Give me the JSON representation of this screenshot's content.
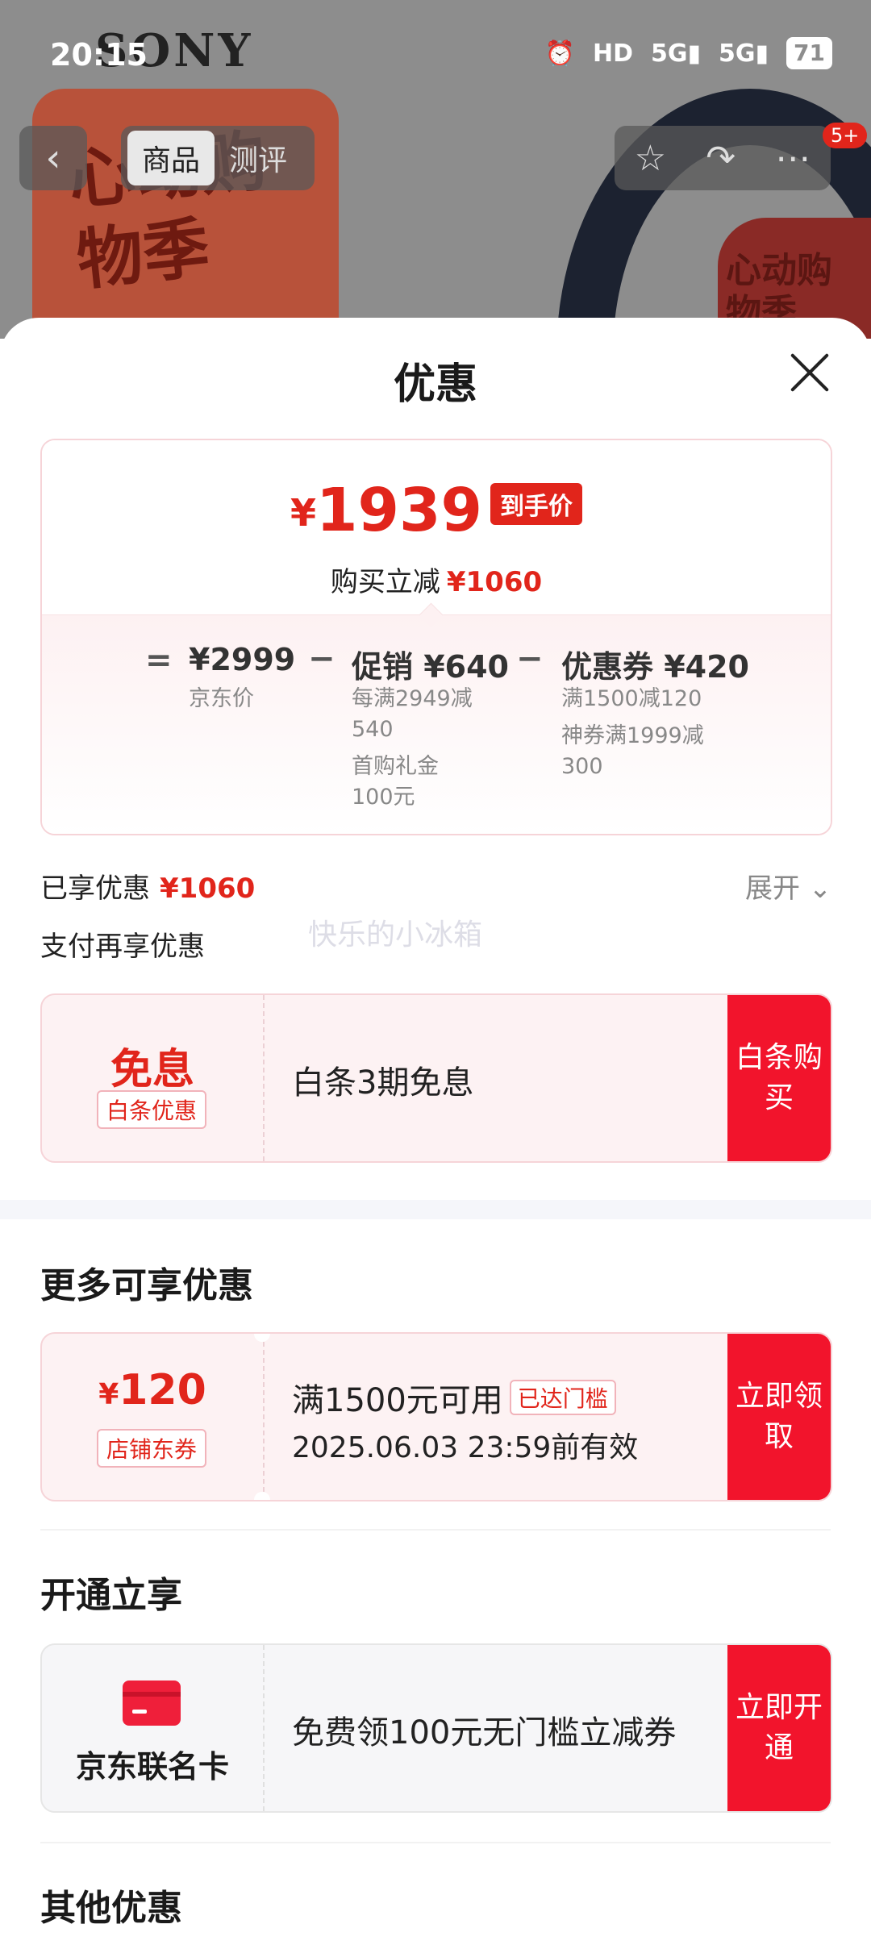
{
  "status_bar": {
    "time": "20:15",
    "hd": "HD",
    "signal1": "5G",
    "signal2": "5G",
    "battery": "71"
  },
  "header": {
    "brand": "SONY",
    "promo": "心动购物季",
    "badge_promo": "心动购物季",
    "tabs": [
      "商品",
      "测评"
    ],
    "message_count": "5+"
  },
  "sheet": {
    "title": "优惠",
    "final_price": {
      "currency": "¥",
      "amount": "1939",
      "tag": "到手价",
      "reduction_label": "购买立减",
      "reduction_value": "¥1060"
    },
    "breakdown": {
      "eq": "=",
      "minus": "−",
      "jd_price": "¥2999",
      "jd_price_label": "京东价",
      "promo_value": "促销 ¥640",
      "promo_line1": "每满2949减540",
      "promo_line2": "首购礼金100元",
      "coupon_value": "优惠券 ¥420",
      "coupon_line1": "满1500减120",
      "coupon_line2": "神券满1999减300"
    },
    "enjoyed_label": "已享优惠",
    "enjoyed_value": "¥1060",
    "expand_label": "展开",
    "pay_more_label": "支付再享优惠",
    "watermark": "快乐的小冰箱",
    "baitiao": {
      "big": "免息",
      "tag": "白条优惠",
      "text": "白条3期免息",
      "button": "白条购买"
    },
    "more_title": "更多可享优惠",
    "store_coupon": {
      "currency": "¥",
      "amount": "120",
      "tag": "店铺东券",
      "condition": "满1500元可用",
      "condition_tag": "已达门槛",
      "expiry": "2025.06.03 23:59前有效",
      "button": "立即领取"
    },
    "open_title": "开通立享",
    "cobrand": {
      "name": "京东联名卡",
      "text": "免费领100元无门槛立减券",
      "button": "立即开通"
    },
    "other_title": "其他优惠"
  }
}
